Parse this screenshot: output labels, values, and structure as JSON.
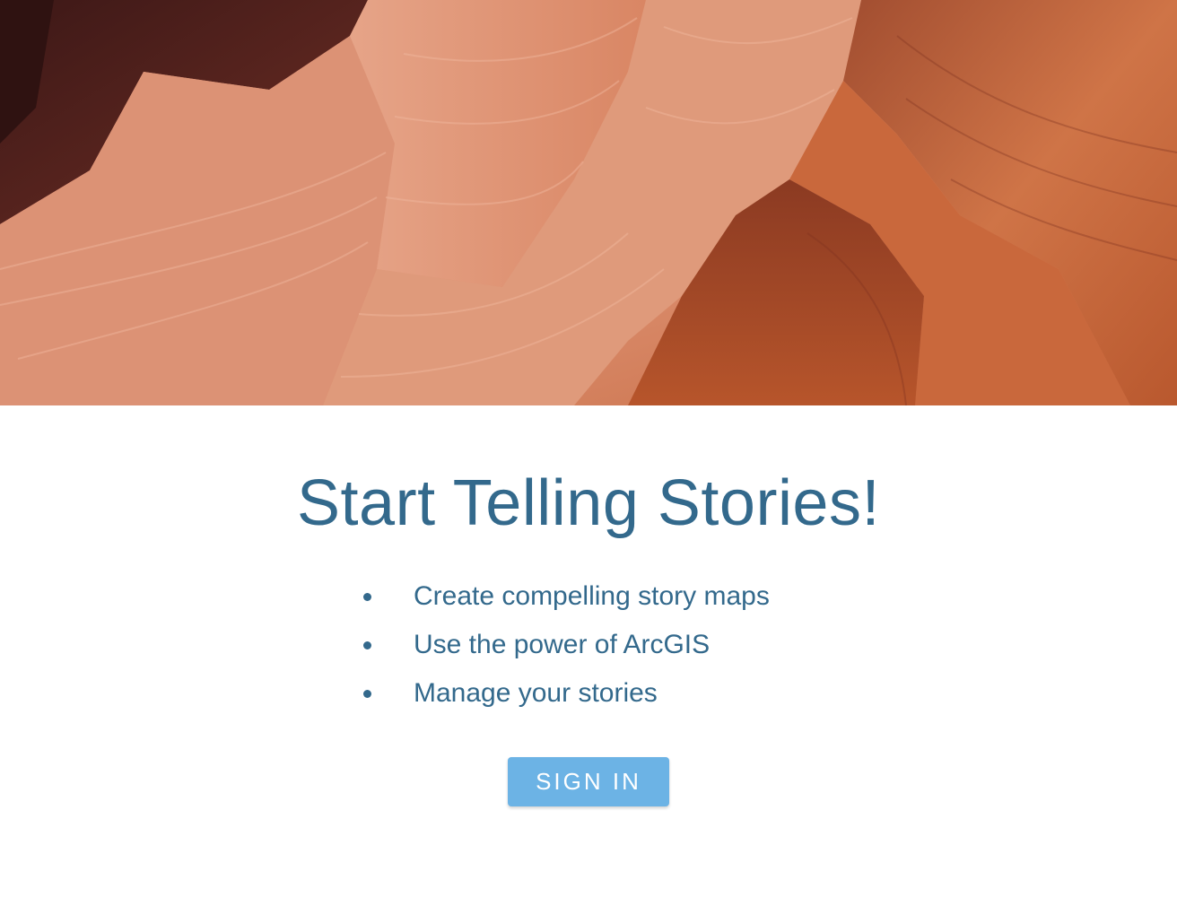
{
  "hero": {
    "image_name": "sandstone-canyon-photo",
    "colors": {
      "deep": "#4a1e1a",
      "dark": "#7a3527",
      "mid": "#b85a3c",
      "light": "#e39f82",
      "highlight": "#f0b79c"
    }
  },
  "main": {
    "title": "Start Telling Stories!",
    "features": [
      "Create compelling story maps",
      "Use the power of ArcGIS",
      "Manage your stories"
    ],
    "signin_label": "SIGN IN"
  },
  "colors": {
    "text": "#33698c",
    "button": "#6cb3e5",
    "button_text": "#ffffff",
    "background": "#ffffff"
  }
}
